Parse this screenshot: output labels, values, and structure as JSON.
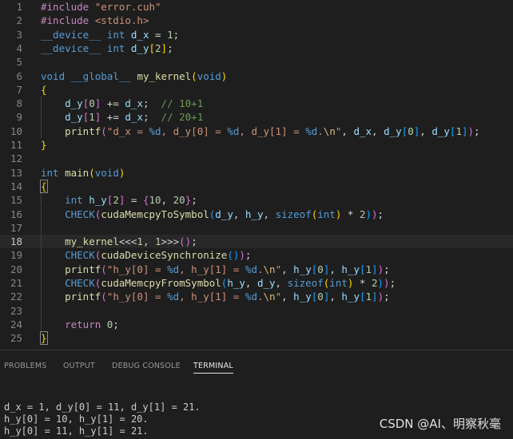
{
  "editor": {
    "current_line": 18,
    "lines": [
      {
        "n": "1",
        "tokens": [
          [
            "#include ",
            "pp"
          ],
          [
            "\"error.cuh\"",
            "str"
          ]
        ]
      },
      {
        "n": "2",
        "tokens": [
          [
            "#include ",
            "pp"
          ],
          [
            "<stdio.h>",
            "str"
          ]
        ]
      },
      {
        "n": "3",
        "tokens": [
          [
            "__device__",
            "kw"
          ],
          [
            " int ",
            "kw"
          ],
          [
            "d_x",
            "var"
          ],
          [
            " = ",
            "pun"
          ],
          [
            "1",
            "num"
          ],
          [
            ";",
            "pun"
          ]
        ]
      },
      {
        "n": "4",
        "tokens": [
          [
            "__device__",
            "kw"
          ],
          [
            " int ",
            "kw"
          ],
          [
            "d_y",
            "var"
          ],
          [
            "[",
            "br1"
          ],
          [
            "2",
            "num"
          ],
          [
            "]",
            "br1"
          ],
          [
            ";",
            "pun"
          ]
        ]
      },
      {
        "n": "5",
        "tokens": []
      },
      {
        "n": "6",
        "tokens": [
          [
            "void",
            "kw"
          ],
          [
            " __global__ ",
            "kw"
          ],
          [
            "my_kernel",
            "fn"
          ],
          [
            "(",
            "br1"
          ],
          [
            "void",
            "kw"
          ],
          [
            ")",
            "br1"
          ]
        ]
      },
      {
        "n": "7",
        "tokens": [
          [
            "{",
            "br1"
          ]
        ]
      },
      {
        "n": "8",
        "tokens": [
          [
            "    ",
            "txt"
          ],
          [
            "d_y",
            "var"
          ],
          [
            "[",
            "br2"
          ],
          [
            "0",
            "num"
          ],
          [
            "]",
            "br2"
          ],
          [
            " += ",
            "pun"
          ],
          [
            "d_x",
            "var"
          ],
          [
            ";  ",
            "pun"
          ],
          [
            "// 10+1",
            "cmt"
          ]
        ]
      },
      {
        "n": "9",
        "tokens": [
          [
            "    ",
            "txt"
          ],
          [
            "d_y",
            "var"
          ],
          [
            "[",
            "br2"
          ],
          [
            "1",
            "num"
          ],
          [
            "]",
            "br2"
          ],
          [
            " += ",
            "pun"
          ],
          [
            "d_x",
            "var"
          ],
          [
            ";  ",
            "pun"
          ],
          [
            "// 20+1",
            "cmt"
          ]
        ]
      },
      {
        "n": "10",
        "tokens": [
          [
            "    ",
            "txt"
          ],
          [
            "printf",
            "fn"
          ],
          [
            "(",
            "br2"
          ],
          [
            "\"d_x = ",
            "str"
          ],
          [
            "%d",
            "kw"
          ],
          [
            ", d_y[0] = ",
            "str"
          ],
          [
            "%d",
            "kw"
          ],
          [
            ", d_y[1] = ",
            "str"
          ],
          [
            "%d",
            "kw"
          ],
          [
            ".",
            "str"
          ],
          [
            "\\n",
            "esc"
          ],
          [
            "\"",
            "str"
          ],
          [
            ", ",
            "pun"
          ],
          [
            "d_x",
            "var"
          ],
          [
            ", ",
            "pun"
          ],
          [
            "d_y",
            "var"
          ],
          [
            "[",
            "br3"
          ],
          [
            "0",
            "num"
          ],
          [
            "]",
            "br3"
          ],
          [
            ", ",
            "pun"
          ],
          [
            "d_y",
            "var"
          ],
          [
            "[",
            "br3"
          ],
          [
            "1",
            "num"
          ],
          [
            "]",
            "br3"
          ],
          [
            ")",
            "br2"
          ],
          [
            ";",
            "pun"
          ]
        ]
      },
      {
        "n": "11",
        "tokens": [
          [
            "}",
            "br1"
          ]
        ]
      },
      {
        "n": "12",
        "tokens": []
      },
      {
        "n": "13",
        "tokens": [
          [
            "int",
            "kw"
          ],
          [
            " ",
            "txt"
          ],
          [
            "main",
            "fn"
          ],
          [
            "(",
            "br1"
          ],
          [
            "void",
            "kw"
          ],
          [
            ")",
            "br1"
          ]
        ]
      },
      {
        "n": "14",
        "tokens": [
          [
            "{",
            "br1b"
          ]
        ]
      },
      {
        "n": "15",
        "tokens": [
          [
            "    ",
            "txt"
          ],
          [
            "int",
            "kw"
          ],
          [
            " ",
            "txt"
          ],
          [
            "h_y",
            "var"
          ],
          [
            "[",
            "br2"
          ],
          [
            "2",
            "num"
          ],
          [
            "]",
            "br2"
          ],
          [
            " = ",
            "pun"
          ],
          [
            "{",
            "br2"
          ],
          [
            "10",
            "num"
          ],
          [
            ", ",
            "pun"
          ],
          [
            "20",
            "num"
          ],
          [
            "}",
            "br2"
          ],
          [
            ";",
            "pun"
          ]
        ]
      },
      {
        "n": "16",
        "tokens": [
          [
            "    ",
            "txt"
          ],
          [
            "CHECK",
            "kw"
          ],
          [
            "(",
            "br2"
          ],
          [
            "cudaMemcpyToSymbol",
            "fn"
          ],
          [
            "(",
            "br3"
          ],
          [
            "d_y",
            "var"
          ],
          [
            ", ",
            "pun"
          ],
          [
            "h_y",
            "var"
          ],
          [
            ", ",
            "pun"
          ],
          [
            "sizeof",
            "kw"
          ],
          [
            "(",
            "br1"
          ],
          [
            "int",
            "kw"
          ],
          [
            ")",
            "br1"
          ],
          [
            " * ",
            "pun"
          ],
          [
            "2",
            "num"
          ],
          [
            ")",
            "br3"
          ],
          [
            ")",
            "br2"
          ],
          [
            ";",
            "pun"
          ]
        ]
      },
      {
        "n": "17",
        "tokens": []
      },
      {
        "n": "18",
        "tokens": [
          [
            "    ",
            "txt"
          ],
          [
            "my_kernel",
            "fn"
          ],
          [
            "<<<",
            "pun"
          ],
          [
            "1",
            "num"
          ],
          [
            ", ",
            "pun"
          ],
          [
            "1",
            "num"
          ],
          [
            ">>>",
            "pun"
          ],
          [
            "()",
            "br2"
          ],
          [
            ";",
            "pun"
          ]
        ]
      },
      {
        "n": "19",
        "tokens": [
          [
            "    ",
            "txt"
          ],
          [
            "CHECK",
            "kw"
          ],
          [
            "(",
            "br2"
          ],
          [
            "cudaDeviceSynchronize",
            "fn"
          ],
          [
            "()",
            "br3"
          ],
          [
            ")",
            "br2"
          ],
          [
            ";",
            "pun"
          ]
        ]
      },
      {
        "n": "20",
        "tokens": [
          [
            "    ",
            "txt"
          ],
          [
            "printf",
            "fn"
          ],
          [
            "(",
            "br2"
          ],
          [
            "\"h_y[0] = ",
            "str"
          ],
          [
            "%d",
            "kw"
          ],
          [
            ", h_y[1] = ",
            "str"
          ],
          [
            "%d",
            "kw"
          ],
          [
            ".",
            "str"
          ],
          [
            "\\n",
            "esc"
          ],
          [
            "\"",
            "str"
          ],
          [
            ", ",
            "pun"
          ],
          [
            "h_y",
            "var"
          ],
          [
            "[",
            "br3"
          ],
          [
            "0",
            "num"
          ],
          [
            "]",
            "br3"
          ],
          [
            ", ",
            "pun"
          ],
          [
            "h_y",
            "var"
          ],
          [
            "[",
            "br3"
          ],
          [
            "1",
            "num"
          ],
          [
            "]",
            "br3"
          ],
          [
            ")",
            "br2"
          ],
          [
            ";",
            "pun"
          ]
        ]
      },
      {
        "n": "21",
        "tokens": [
          [
            "    ",
            "txt"
          ],
          [
            "CHECK",
            "kw"
          ],
          [
            "(",
            "br2"
          ],
          [
            "cudaMemcpyFromSymbol",
            "fn"
          ],
          [
            "(",
            "br3"
          ],
          [
            "h_y",
            "var"
          ],
          [
            ", ",
            "pun"
          ],
          [
            "d_y",
            "var"
          ],
          [
            ", ",
            "pun"
          ],
          [
            "sizeof",
            "kw"
          ],
          [
            "(",
            "br1"
          ],
          [
            "int",
            "kw"
          ],
          [
            ")",
            "br1"
          ],
          [
            " * ",
            "pun"
          ],
          [
            "2",
            "num"
          ],
          [
            ")",
            "br3"
          ],
          [
            ")",
            "br2"
          ],
          [
            ";",
            "pun"
          ]
        ]
      },
      {
        "n": "22",
        "tokens": [
          [
            "    ",
            "txt"
          ],
          [
            "printf",
            "fn"
          ],
          [
            "(",
            "br2"
          ],
          [
            "\"h_y[0] = ",
            "str"
          ],
          [
            "%d",
            "kw"
          ],
          [
            ", h_y[1] = ",
            "str"
          ],
          [
            "%d",
            "kw"
          ],
          [
            ".",
            "str"
          ],
          [
            "\\n",
            "esc"
          ],
          [
            "\"",
            "str"
          ],
          [
            ", ",
            "pun"
          ],
          [
            "h_y",
            "var"
          ],
          [
            "[",
            "br3"
          ],
          [
            "0",
            "num"
          ],
          [
            "]",
            "br3"
          ],
          [
            ", ",
            "pun"
          ],
          [
            "h_y",
            "var"
          ],
          [
            "[",
            "br3"
          ],
          [
            "1",
            "num"
          ],
          [
            "]",
            "br3"
          ],
          [
            ")",
            "br2"
          ],
          [
            ";",
            "pun"
          ]
        ]
      },
      {
        "n": "23",
        "tokens": []
      },
      {
        "n": "24",
        "tokens": [
          [
            "    ",
            "txt"
          ],
          [
            "return",
            "ctl"
          ],
          [
            " ",
            "txt"
          ],
          [
            "0",
            "num"
          ],
          [
            ";",
            "pun"
          ]
        ]
      },
      {
        "n": "25",
        "tokens": [
          [
            "}",
            "br1b"
          ]
        ]
      }
    ]
  },
  "panel": {
    "tabs": [
      {
        "label": "PROBLEMS",
        "active": false
      },
      {
        "label": "OUTPUT",
        "active": false
      },
      {
        "label": "DEBUG CONSOLE",
        "active": false
      },
      {
        "label": "TERMINAL",
        "active": true
      }
    ],
    "terminal_lines": [
      "d_x = 1, d_y[0] = 11, d_y[1] = 21.",
      "h_y[0] = 10, h_y[1] = 20.",
      "h_y[0] = 11, h_y[1] = 21."
    ]
  },
  "watermark": "CSDN @AI、明察秋毫"
}
